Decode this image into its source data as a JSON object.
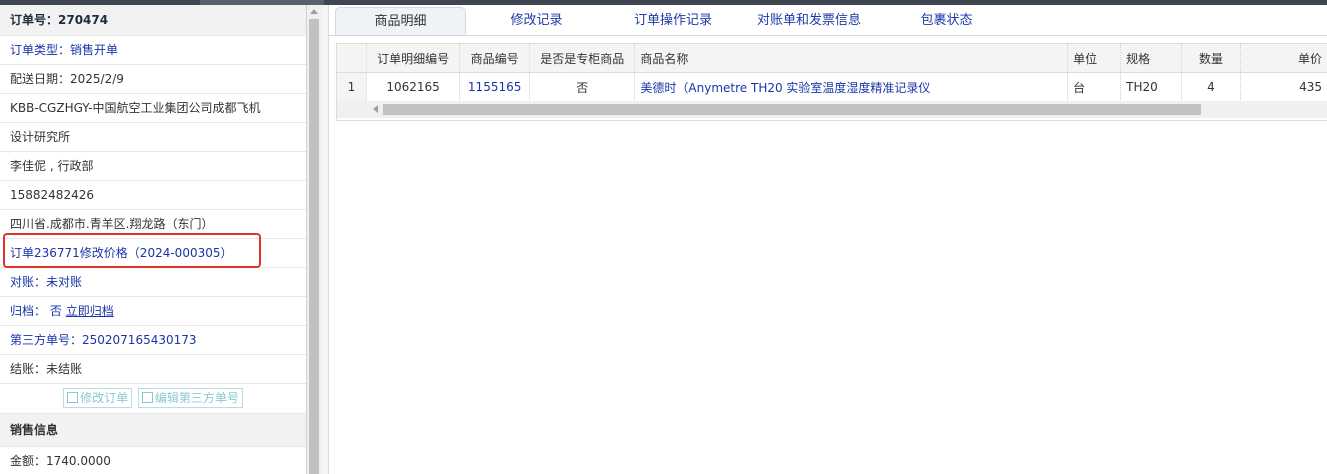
{
  "order": {
    "title": "订单号：270474",
    "type": "订单类型：销售开单",
    "delivery_date": "配送日期：2025/2/9",
    "customer_line1": "KBB-CGZHGY-中国航空工业集团公司成都飞机",
    "customer_line2": "设计研究所",
    "contact": "李佳伲 , 行政部",
    "phone": "15882482426",
    "address": "四川省.成都市.青羊区.翔龙路（东门）",
    "price_change": "订单236771修改价格（2024-000305）",
    "reconcile": "对账：未对账",
    "archive_label": "归档：",
    "archive_value": "否",
    "archive_link": "立即归档",
    "third_party": "第三方单号：250207165430173",
    "settle": "结账：未结账"
  },
  "buttons": {
    "edit_order": "修改订单",
    "edit_third": "编辑第三方单号"
  },
  "sales": {
    "title": "销售信息",
    "amount": "金额：1740.0000"
  },
  "tabs": [
    "商品明细",
    "修改记录",
    "订单操作记录",
    "对账单和发票信息",
    "包裹状态"
  ],
  "table": {
    "columns": [
      "",
      "订单明细编号",
      "商品编号",
      "是否是专柜商品",
      "商品名称",
      "单位",
      "规格",
      "数量",
      "单价"
    ],
    "rows": [
      [
        "1",
        "1062165",
        "1155165",
        "否",
        "美德时（Anymetre TH20 实验室温度湿度精准记录仪",
        "台",
        "TH20",
        "4",
        "435"
      ]
    ]
  }
}
